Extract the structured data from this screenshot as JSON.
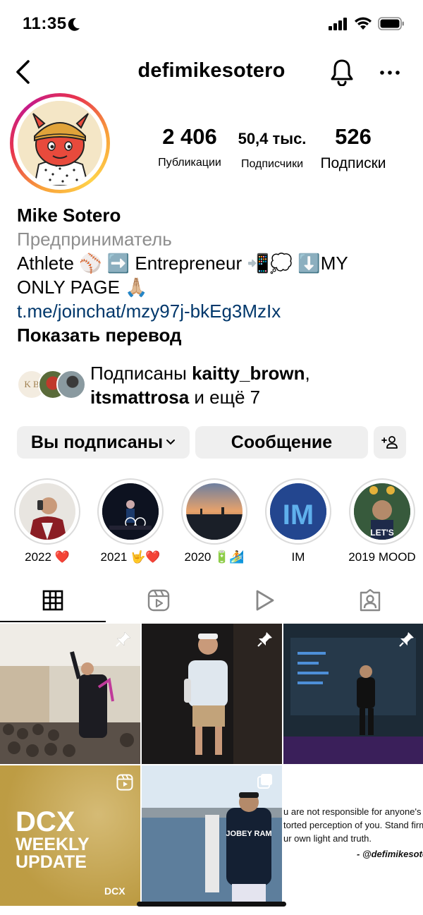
{
  "status": {
    "time": "11:35"
  },
  "header": {
    "username": "defimikesotero"
  },
  "stats": [
    {
      "value": "2 406",
      "label": "Публикации"
    },
    {
      "value": "50,4 тыс.",
      "label": "Подписчики"
    },
    {
      "value": "526",
      "label": "Подписки"
    }
  ],
  "bio": {
    "name": "Mike Sotero",
    "category": "Предприниматель",
    "line1": "Athlete ⚾ ➡️ Entrepreneur 📲💭 ⬇️MY",
    "line2": "ONLY PAGE 🙏🏼",
    "link": "t.me/joinchat/mzy97j-bkEg3MzIx",
    "translate": "Показать перевод"
  },
  "followed_by": {
    "prefix": "Подписаны ",
    "user1": "kaitty_brown",
    "sep": ",",
    "user2": "itsmattrosa",
    "suffix": " и ещё 7",
    "avatar1_text": "K B"
  },
  "buttons": {
    "following": "Вы подписаны",
    "message": "Сообщение"
  },
  "highlights": [
    {
      "label": "2022 ❤️"
    },
    {
      "label": "2021 🤟❤️"
    },
    {
      "label": "2020 🔋🏄"
    },
    {
      "label": "IM"
    },
    {
      "label": "2019 MOOD"
    }
  ],
  "highlight_texts": {
    "im": "IM",
    "lets": "LET'S"
  },
  "grid": {
    "post4_line1": "DCX",
    "post4_line2": "WEEKLY",
    "post4_line3": "UPDATE",
    "post4_logo": "DCX",
    "post6_line1": "u are not responsible for anyone's",
    "post6_line2": "torted perception of you. Stand firm",
    "post6_line3": "ur own light and truth.",
    "post6_author": "- @defimikesoter",
    "post5_shirt": "JOBEY RAM"
  },
  "colors": {
    "link": "#00376b",
    "muted": "#8e8e8e",
    "button_bg": "#efefef"
  }
}
